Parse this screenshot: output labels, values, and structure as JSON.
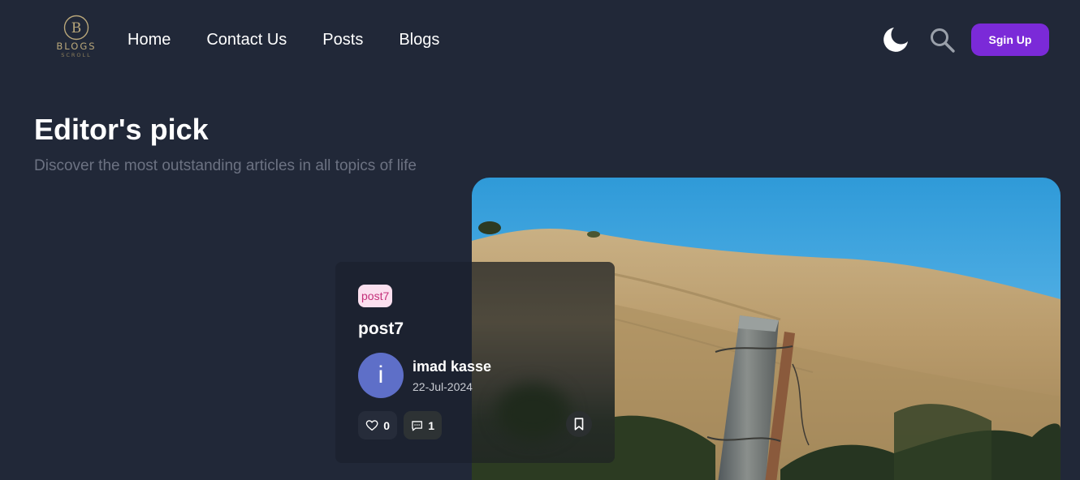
{
  "header": {
    "logo": {
      "word": "BLOGS",
      "sub": "SCROLL",
      "monogram": "B"
    },
    "nav": [
      {
        "label": "Home"
      },
      {
        "label": "Contact Us"
      },
      {
        "label": "Posts"
      },
      {
        "label": "Blogs"
      }
    ],
    "theme_toggle_icon": "moon-icon",
    "search_icon": "search-icon",
    "signup_label": "Sgin Up"
  },
  "section": {
    "title": "Editor's pick",
    "subtitle": "Discover the most outstanding articles in all topics of life"
  },
  "post": {
    "tag": "post7",
    "title": "post7",
    "author": {
      "initial": "i",
      "name": "imad kasse"
    },
    "date": "22-Jul-2024",
    "likes": "0",
    "comments": "1",
    "image_description": "hillside-fence-post-photo"
  },
  "colors": {
    "background": "#212838",
    "accent": "#7b2ad8",
    "tag_bg": "#fbe0ef",
    "tag_text": "#c4307a",
    "avatar": "#5e6fc8"
  }
}
